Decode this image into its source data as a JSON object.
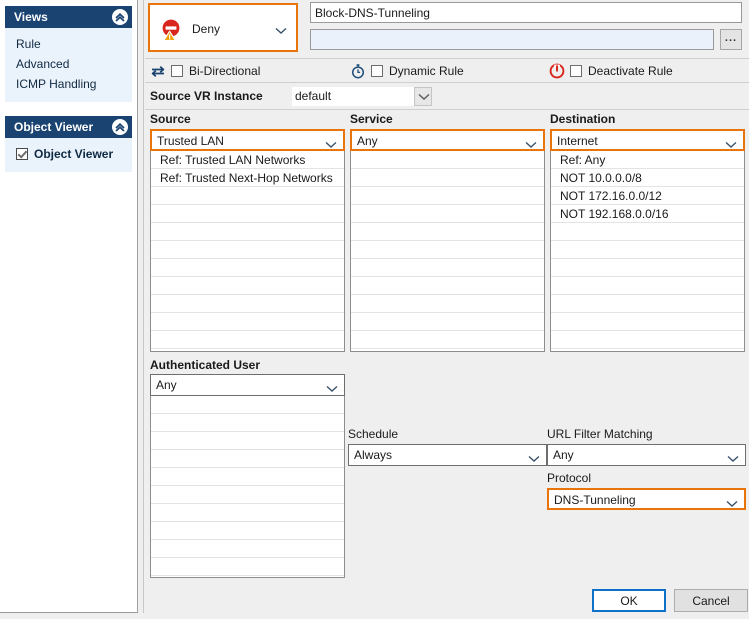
{
  "sidebar": {
    "panels": [
      {
        "title": "Views",
        "collapse_icon": "double-chevron-up-icon",
        "items": [
          {
            "label": "Rule"
          },
          {
            "label": "Advanced"
          },
          {
            "label": "ICMP Handling"
          }
        ]
      },
      {
        "title": "Object Viewer",
        "collapse_icon": "double-chevron-up-icon",
        "checkbox": {
          "label": "Object Viewer",
          "checked": true
        }
      }
    ]
  },
  "rule": {
    "action": {
      "label": "Deny",
      "icon": "deny-warning-icon",
      "highlight_color": "#e8740c"
    },
    "name": {
      "value": "Block-DNS-Tunneling",
      "placeholder": ""
    },
    "description": {
      "value": "",
      "placeholder": ""
    },
    "browse_button": {
      "label": "...",
      "icon": "ellipsis-icon"
    },
    "options": [
      {
        "label": "Bi-Directional",
        "icon": "bidirectional-arrows-icon",
        "checked": false
      },
      {
        "label": "Dynamic Rule",
        "icon": "stopwatch-icon",
        "checked": false
      },
      {
        "label": "Deactivate Rule",
        "icon": "power-icon",
        "checked": false
      }
    ],
    "source_vr_instance": {
      "label": "Source VR Instance",
      "value": "default"
    }
  },
  "columns": [
    {
      "label": "Source",
      "selected": "Trusted  LAN",
      "highlighted": true,
      "entries": [
        "Ref: Trusted LAN Networks",
        "Ref: Trusted Next-Hop Networks"
      ]
    },
    {
      "label": "Service",
      "selected": "Any",
      "highlighted": true,
      "entries": []
    },
    {
      "label": "Destination",
      "selected": "Internet",
      "highlighted": true,
      "entries": [
        "Ref: Any",
        "NOT 10.0.0.0/8",
        "NOT 172.16.0.0/12",
        "NOT 192.168.0.0/16"
      ]
    }
  ],
  "authenticated_user": {
    "label": "Authenticated User",
    "selected": "Any",
    "entries": []
  },
  "fields": {
    "schedule": {
      "label": "Schedule",
      "value": "Always",
      "highlighted": false
    },
    "url_filter_matching": {
      "label": "URL Filter Matching",
      "value": "Any",
      "highlighted": false
    },
    "protocol": {
      "label": "Protocol",
      "value": "DNS-Tunneling",
      "highlighted": true
    }
  },
  "footer": {
    "ok_label": "OK",
    "cancel_label": "Cancel"
  },
  "colors": {
    "highlight": "#e8740c",
    "panel_header": "#1b4371",
    "focus_blue": "#0d71c8"
  }
}
